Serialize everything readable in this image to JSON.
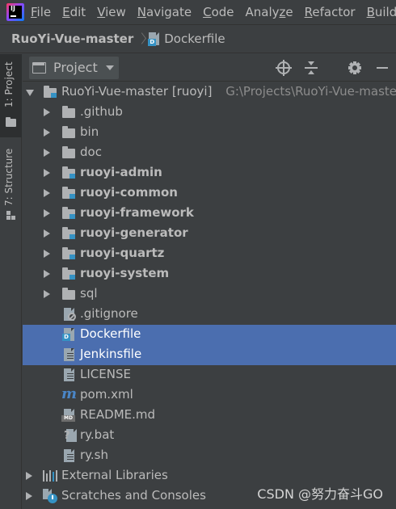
{
  "menubar": {
    "items": [
      {
        "u": "F",
        "rest": "ile"
      },
      {
        "u": "E",
        "rest": "dit"
      },
      {
        "u": "V",
        "rest": "iew"
      },
      {
        "u": "N",
        "rest": "avigate"
      },
      {
        "u": "C",
        "rest": "ode"
      },
      {
        "pre": "Analy",
        "u": "z",
        "rest": "e"
      },
      {
        "u": "R",
        "rest": "efactor"
      },
      {
        "u": "B",
        "rest": "uild"
      }
    ]
  },
  "breadcrumb": {
    "project": "RuoYi-Vue-master",
    "file": "Dockerfile"
  },
  "stripe": {
    "project_label": "1: Project",
    "structure_label": "7: Structure"
  },
  "toolwindow": {
    "title": "Project"
  },
  "tree": {
    "root": {
      "label": "RuoYi-Vue-master [ruoyi]",
      "path": "G:\\Projects\\RuoYi-Vue-master"
    },
    "items": [
      {
        "label": ".github",
        "kind": "folder",
        "bold": false
      },
      {
        "label": "bin",
        "kind": "folder",
        "bold": false
      },
      {
        "label": "doc",
        "kind": "folder",
        "bold": false
      },
      {
        "label": "ruoyi-admin",
        "kind": "module",
        "bold": true
      },
      {
        "label": "ruoyi-common",
        "kind": "module",
        "bold": true
      },
      {
        "label": "ruoyi-framework",
        "kind": "module",
        "bold": true
      },
      {
        "label": "ruoyi-generator",
        "kind": "module",
        "bold": true
      },
      {
        "label": "ruoyi-quartz",
        "kind": "module",
        "bold": true
      },
      {
        "label": "ruoyi-system",
        "kind": "module",
        "bold": true
      },
      {
        "label": "sql",
        "kind": "folder",
        "bold": false
      },
      {
        "label": ".gitignore",
        "kind": "gitignore",
        "bold": false
      },
      {
        "label": "Dockerfile",
        "kind": "docker",
        "bold": false,
        "selected": true
      },
      {
        "label": "Jenkinsfile",
        "kind": "text",
        "bold": false,
        "selected": true
      },
      {
        "label": "LICENSE",
        "kind": "text",
        "bold": false
      },
      {
        "label": "pom.xml",
        "kind": "maven",
        "bold": false
      },
      {
        "label": "README.md",
        "kind": "markdown",
        "bold": false
      },
      {
        "label": "ry.bat",
        "kind": "bat",
        "bold": false
      },
      {
        "label": "ry.sh",
        "kind": "text",
        "bold": false
      }
    ],
    "external_libraries": "External Libraries",
    "scratches": "Scratches and Consoles"
  },
  "watermark": "CSDN @努力奋斗GO",
  "colors": {
    "background": "#3c3f41",
    "selection": "#4b6eaf",
    "text": "#bbbbbb",
    "path": "#8c8c8c",
    "module_badge": "#3592c4"
  }
}
